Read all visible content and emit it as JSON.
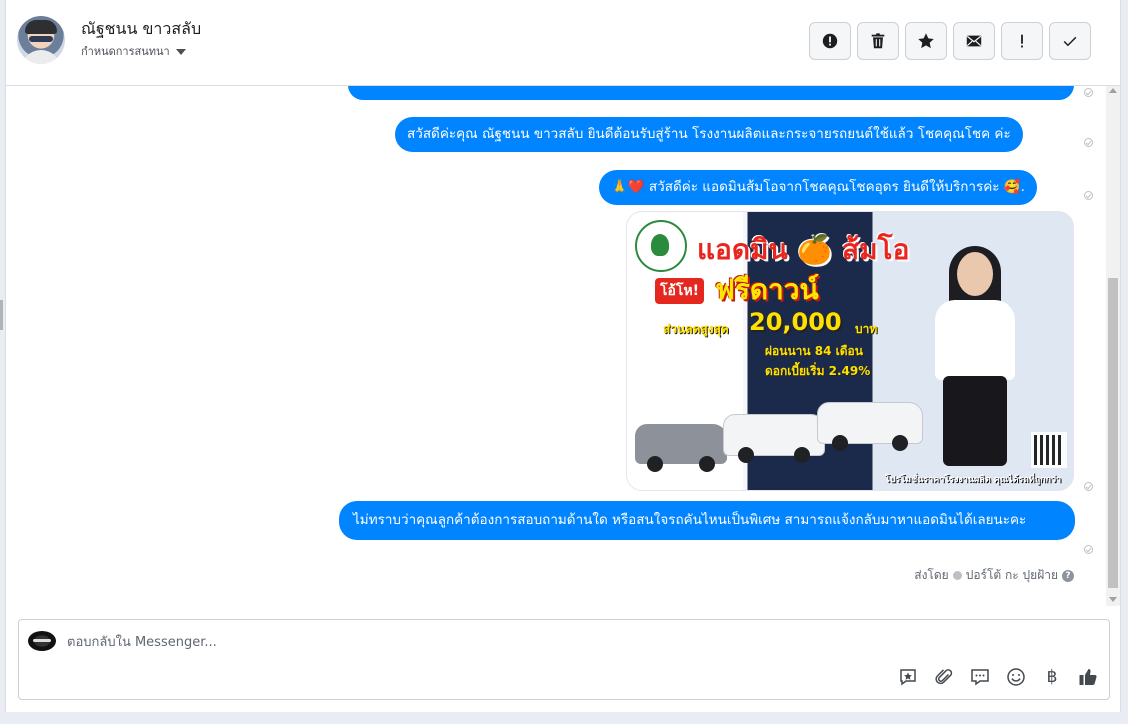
{
  "header": {
    "contact_name": "ณัฐชนน ขาวสลับ",
    "status_dropdown": "กำหนดการสนทนา",
    "actions": [
      {
        "name": "mark-spam",
        "icon": "alert-circle-icon"
      },
      {
        "name": "delete",
        "icon": "trash-icon"
      },
      {
        "name": "star",
        "icon": "star-icon"
      },
      {
        "name": "mark-unread",
        "icon": "envelope-icon"
      },
      {
        "name": "important",
        "icon": "exclamation-icon"
      },
      {
        "name": "mark-done",
        "icon": "checkmark-icon"
      }
    ]
  },
  "messages": [
    {
      "text": "สวัสดีค่ะคุณ ณัฐชนน ขาวสลับ ยินดีต้อนรับสู่ร้าน โรงงานผลิตและกระจายรถยนต์ใช้แล้ว โชคคุณโชค ค่ะ"
    },
    {
      "text": "🙏❤️ สวัสดีค่ะ แอดมินส้มโอจากโชคคุณโชคอุดร ยินดีให้บริการค่ะ 🥰."
    },
    {
      "text": "ไม่ทราบว่าคุณลูกค้าต้องการสอบถามด้านใด หรือสนใจรถคันไหนเป็นพิเศษ สามารถแจ้งกลับมาหาแอดมินได้เลยนะคะ"
    }
  ],
  "promo": {
    "title": "แอดมิน 🍊 ส้มโอ",
    "badge": "โอ้โห!",
    "free_down": "ฟรีดาวน์",
    "discount_label": "ส่วนลดสูงสุด",
    "amount": "20,000",
    "baht": "บาท",
    "installment": "ผ่อนนาน 84 เดือน",
    "interest": "ดอกเบี้ยเริ่ม 2.49%",
    "footer": "โปรโมชั่นราคาโรงงานผลิต คุณได้รถที่ถูกกว่า"
  },
  "sent_by": {
    "label": "ส่งโดย",
    "name": "ปอร์โต้ กะ ปุยฝ้าย",
    "help": "?"
  },
  "composer": {
    "placeholder": "ตอบกลับใน Messenger...",
    "tools": [
      {
        "name": "saved-reply",
        "icon": "saved-reply-icon"
      },
      {
        "name": "attach",
        "icon": "paperclip-icon"
      },
      {
        "name": "quick-replies",
        "icon": "chat-bubbles-icon"
      },
      {
        "name": "emoji",
        "icon": "smiley-icon"
      },
      {
        "name": "payment",
        "icon": "baht-icon",
        "glyph": "฿"
      },
      {
        "name": "like",
        "icon": "thumbs-up-icon"
      }
    ]
  },
  "colors": {
    "bubble": "#0084ff",
    "bubble_text": "#ffffff",
    "border": "#dadde1"
  }
}
